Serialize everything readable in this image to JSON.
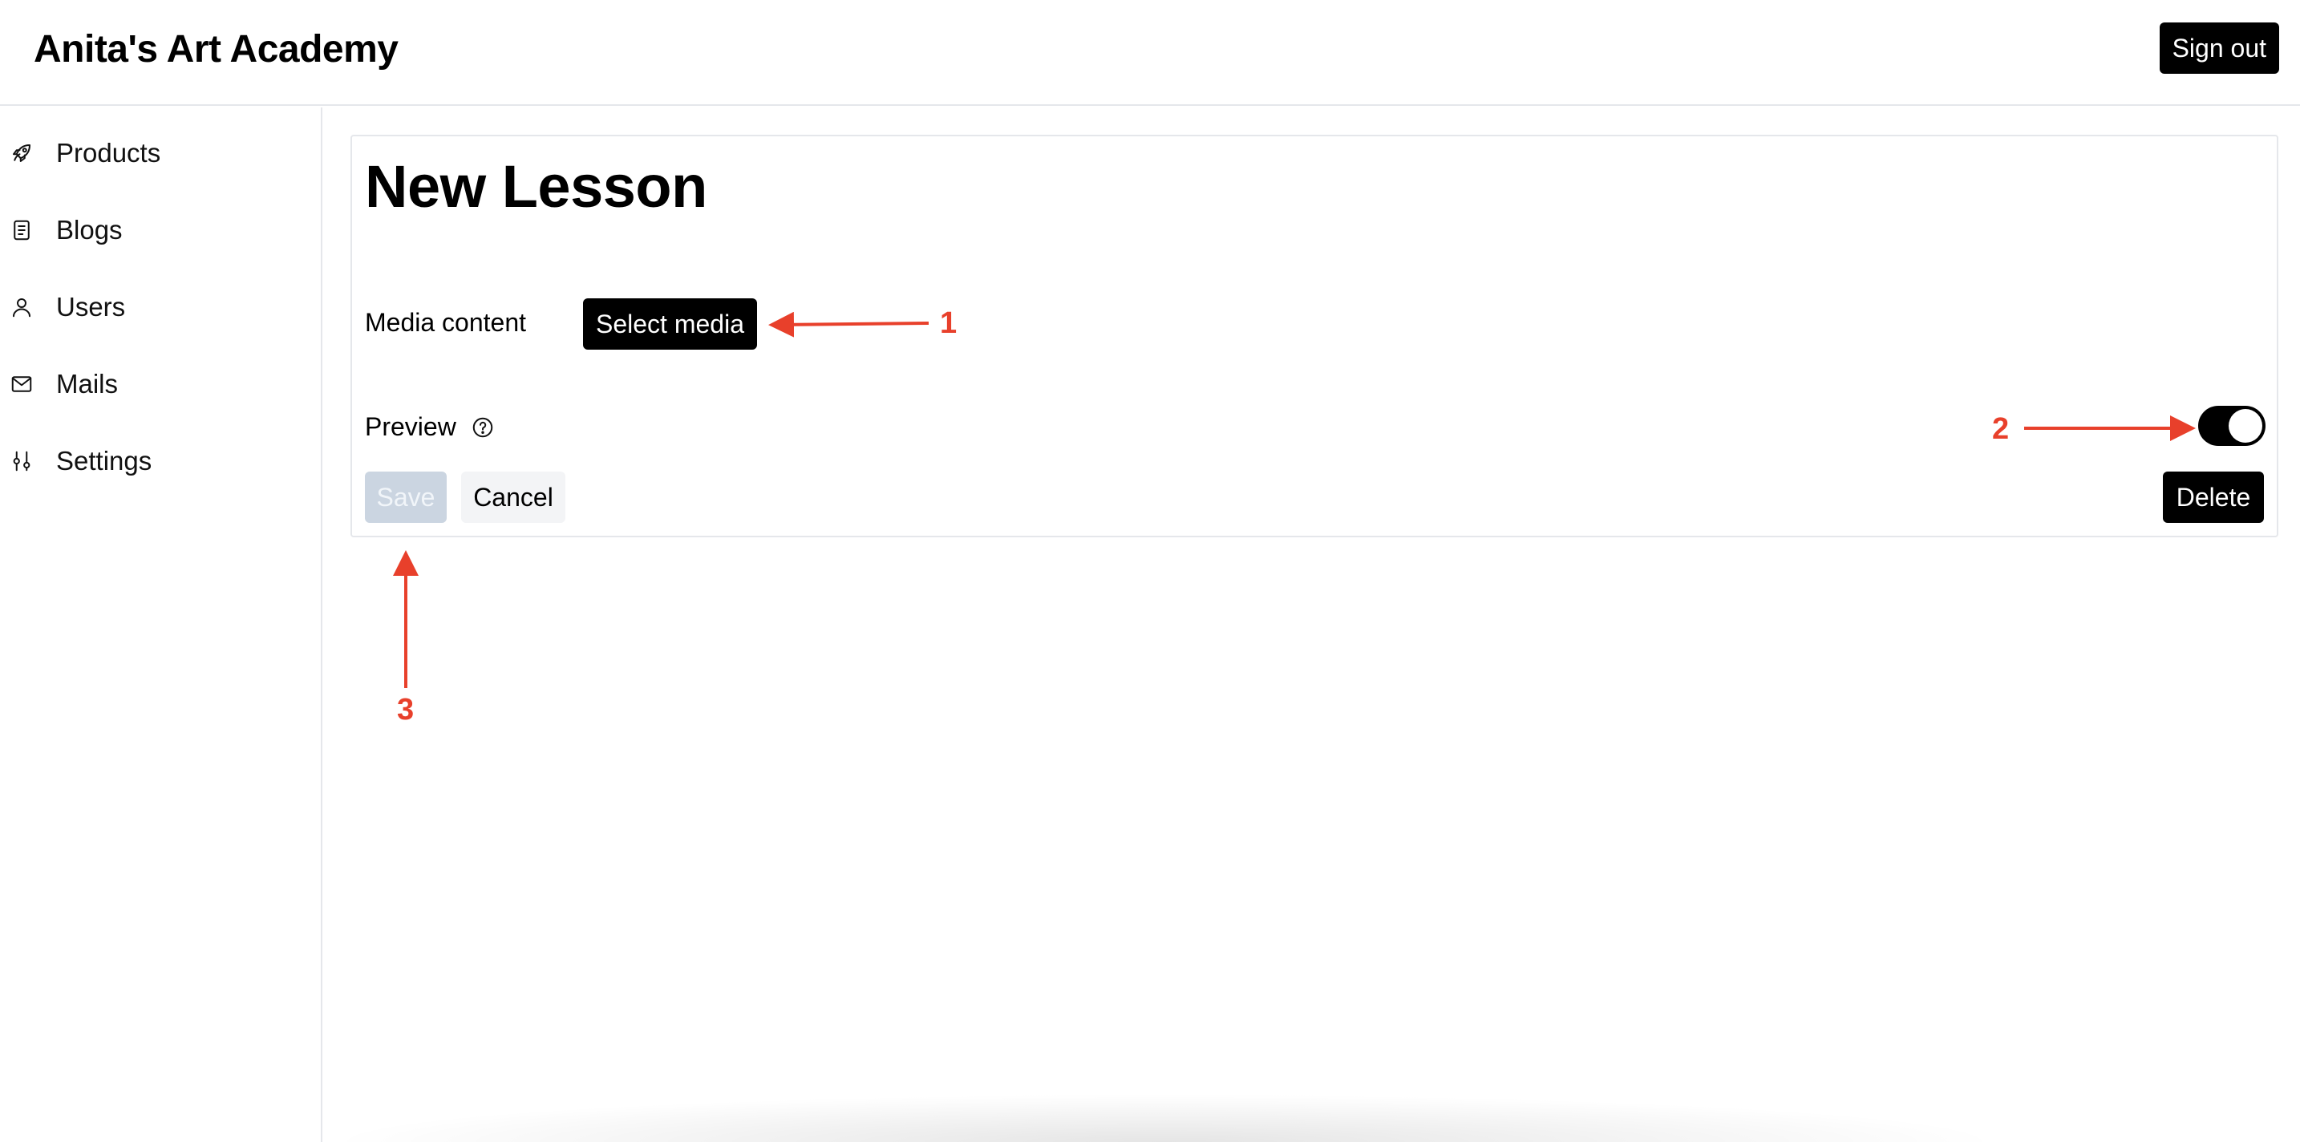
{
  "header": {
    "brand": "Anita's Art Academy",
    "signout_label": "Sign out"
  },
  "sidebar": {
    "items": [
      {
        "label": "Products",
        "icon": "rocket-icon"
      },
      {
        "label": "Blogs",
        "icon": "document-icon"
      },
      {
        "label": "Users",
        "icon": "user-icon"
      },
      {
        "label": "Mails",
        "icon": "mail-icon"
      },
      {
        "label": "Settings",
        "icon": "sliders-icon"
      }
    ]
  },
  "form": {
    "title": "New Lesson",
    "media_label": "Media content",
    "select_media_label": "Select media",
    "preview_label": "Preview",
    "preview_enabled": true,
    "save_label": "Save",
    "save_disabled": true,
    "cancel_label": "Cancel",
    "delete_label": "Delete"
  },
  "annotations": {
    "color": "#e8402b",
    "items": [
      {
        "number": "1",
        "target": "select-media-button"
      },
      {
        "number": "2",
        "target": "preview-toggle"
      },
      {
        "number": "3",
        "target": "save-button"
      }
    ]
  },
  "colors": {
    "primary": "#000000",
    "disabled": "#cbd5e1",
    "border": "#e5e7eb"
  }
}
